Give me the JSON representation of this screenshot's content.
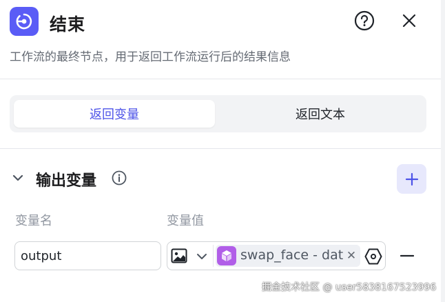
{
  "node": {
    "title": "结束",
    "description": "工作流的最终节点，用于返回工作流运行后的结果信息",
    "icon": "end-node-icon",
    "accent_color": "#5a5cf6"
  },
  "header_actions": {
    "help_icon": "question-circle-icon",
    "close_icon": "close-icon"
  },
  "tabs": [
    {
      "label": "返回变量",
      "active": true
    },
    {
      "label": "返回文本",
      "active": false
    }
  ],
  "output_section": {
    "title": "输出变量",
    "info_icon": "info-icon",
    "add_icon": "plus-icon",
    "columns": {
      "name": "变量名",
      "value": "变量值"
    },
    "rows": [
      {
        "name": "output",
        "value_type_icon": "image-icon",
        "reference": {
          "text": "swap_face - data",
          "icon": "cube-icon",
          "icon_color": "#b15ee8"
        }
      }
    ]
  },
  "watermark": "掘金技术社区 @ user5838167523996"
}
